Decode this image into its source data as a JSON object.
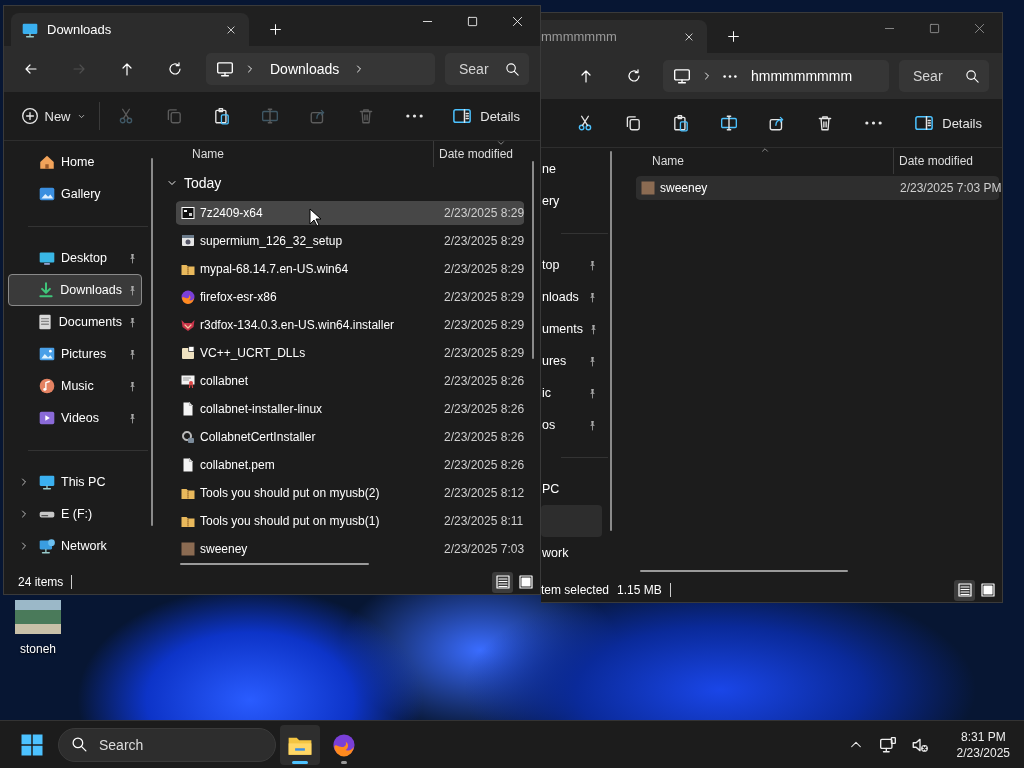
{
  "desktop": {
    "icons": [
      {
        "label": "stoneh"
      }
    ]
  },
  "windows": [
    {
      "active": true,
      "tab": {
        "kind": "pc",
        "title": "Downloads"
      },
      "nav": [
        {
          "kind": "back",
          "disabled": false
        },
        {
          "kind": "forward",
          "disabled": true
        },
        {
          "kind": "up",
          "disabled": false
        },
        {
          "kind": "refresh",
          "disabled": false
        }
      ],
      "address": {
        "collapsed": false,
        "segments": [
          "Downloads"
        ],
        "expandable": true
      },
      "search": {
        "placeholder": "Sear"
      },
      "toolbar": [
        {
          "kind": "new",
          "label": "New",
          "disabled": false
        },
        {
          "kind": "cut",
          "disabled": true
        },
        {
          "kind": "copy",
          "disabled": true
        },
        {
          "kind": "paste",
          "disabled": false
        },
        {
          "kind": "rename",
          "disabled": true
        },
        {
          "kind": "share",
          "disabled": true
        },
        {
          "kind": "delete",
          "disabled": true
        },
        {
          "kind": "more",
          "disabled": false
        },
        {
          "kind": "details",
          "label": "Details",
          "disabled": false
        }
      ],
      "sidebar": {
        "sections": [
          [
            {
              "kind": "home",
              "label": "Home",
              "selected": false
            },
            {
              "kind": "gallery",
              "label": "Gallery",
              "selected": false
            }
          ],
          [
            {
              "kind": "desktop",
              "label": "Desktop",
              "pinned": true,
              "selected": false
            },
            {
              "kind": "downloads",
              "label": "Downloads",
              "pinned": true,
              "selected": true
            },
            {
              "kind": "documents",
              "label": "Documents",
              "pinned": true,
              "selected": false
            },
            {
              "kind": "pictures",
              "label": "Pictures",
              "pinned": true,
              "selected": false
            },
            {
              "kind": "music",
              "label": "Music",
              "pinned": true,
              "selected": false
            },
            {
              "kind": "videos",
              "label": "Videos",
              "pinned": true,
              "selected": false
            }
          ],
          [
            {
              "kind": "pc",
              "label": "This PC",
              "expanded": false,
              "selected": false
            },
            {
              "kind": "drive",
              "label": "E (F:)",
              "expanded": false,
              "selected": false
            },
            {
              "kind": "network",
              "label": "Network",
              "expanded": false,
              "selected": false
            }
          ]
        ]
      },
      "columns": [
        {
          "label": "Name",
          "sorted": false
        },
        {
          "label": "Date modified",
          "sorted": true,
          "descending": true
        }
      ],
      "groups": [
        {
          "label": "Today",
          "expanded": true,
          "rows": [
            {
              "kind": "archive",
              "name": "7z2409-x64",
              "date": "2/23/2025 8:29",
              "selected": true
            },
            {
              "kind": "setup",
              "name": "supermium_126_32_setup",
              "date": "2/23/2025 8:29",
              "selected": false
            },
            {
              "kind": "zip",
              "name": "mypal-68.14.7.en-US.win64",
              "date": "2/23/2025 8:29",
              "selected": false
            },
            {
              "kind": "browser",
              "name": "firefox-esr-x86",
              "date": "2/23/2025 8:29",
              "selected": false
            },
            {
              "kind": "fox",
              "name": "r3dfox-134.0.3.en-US.win64.installer",
              "date": "2/23/2025 8:29",
              "selected": false
            },
            {
              "kind": "sfx",
              "name": "VC++_UCRT_DLLs",
              "date": "2/23/2025 8:29",
              "selected": false
            },
            {
              "kind": "certificate",
              "name": "collabnet",
              "date": "2/23/2025 8:26",
              "selected": false
            },
            {
              "kind": "file",
              "name": "collabnet-installer-linux",
              "date": "2/23/2025 8:26",
              "selected": false
            },
            {
              "kind": "installer",
              "name": "CollabnetCertInstaller",
              "date": "2/23/2025 8:26",
              "selected": false
            },
            {
              "kind": "file",
              "name": "collabnet.pem",
              "date": "2/23/2025 8:26",
              "selected": false
            },
            {
              "kind": "zip",
              "name": "Tools you should put on myusb(2)",
              "date": "2/23/2025 8:12",
              "selected": false
            },
            {
              "kind": "zip",
              "name": "Tools you should put on myusb(1)",
              "date": "2/23/2025 8:11",
              "selected": false
            },
            {
              "kind": "photo",
              "name": "sweeney",
              "date": "2/23/2025 7:03",
              "selected": false
            }
          ]
        }
      ],
      "status": {
        "text": "24 items"
      },
      "views": [
        {
          "kind": "details",
          "selected": true
        },
        {
          "kind": "tiles",
          "selected": false
        }
      ]
    },
    {
      "active": false,
      "tab": {
        "title": "mmmmmmm"
      },
      "nav": [
        {
          "kind": "up",
          "disabled": false
        },
        {
          "kind": "refresh",
          "disabled": false
        }
      ],
      "address": {
        "collapsed": true,
        "segments": [
          "hmmmmmmmm"
        ],
        "expandable": false
      },
      "search": {
        "placeholder": "Sear"
      },
      "toolbar": [
        {
          "kind": "cut",
          "disabled": false
        },
        {
          "kind": "copy",
          "disabled": false
        },
        {
          "kind": "paste",
          "disabled": false
        },
        {
          "kind": "rename",
          "disabled": false
        },
        {
          "kind": "share",
          "disabled": false
        },
        {
          "kind": "delete",
          "disabled": false
        },
        {
          "kind": "more",
          "disabled": false
        },
        {
          "kind": "details",
          "label": "Details",
          "disabled": false
        }
      ],
      "sidebar": {
        "sections": [
          [
            {
              "label": "ne",
              "selected": false
            },
            {
              "label": "ery",
              "selected": false
            }
          ],
          [
            {
              "label": "top",
              "pinned": true,
              "selected": false
            },
            {
              "label": "nloads",
              "pinned": true,
              "selected": false
            },
            {
              "label": "uments",
              "pinned": true,
              "selected": false
            },
            {
              "label": "ures",
              "pinned": true,
              "selected": false
            },
            {
              "label": "ic",
              "pinned": true,
              "selected": false
            },
            {
              "label": "os",
              "pinned": true,
              "selected": false
            }
          ],
          [
            {
              "label": "PC",
              "selected": false
            },
            {
              "selected": true
            },
            {
              "label": "work",
              "selected": false
            }
          ]
        ]
      },
      "columns": [
        {
          "label": "Name",
          "sorted": true,
          "descending": false
        },
        {
          "label": "Date modified",
          "sorted": false
        }
      ],
      "rows": [
        {
          "kind": "photo",
          "name": "sweeney",
          "date": "2/23/2025 7:03 PM",
          "selected": true
        }
      ],
      "status": {
        "text": "tem selected",
        "size": "1.15 MB"
      },
      "views": [
        {
          "kind": "details",
          "selected": true
        },
        {
          "kind": "tiles",
          "selected": false
        }
      ]
    }
  ],
  "taskbar": {
    "search": {
      "placeholder": "Search"
    },
    "apps": [
      {
        "kind": "explorer",
        "active": true
      },
      {
        "kind": "firefox",
        "active": false
      }
    ],
    "clock": {
      "time": "8:31 PM",
      "date": "2/23/2025"
    }
  }
}
